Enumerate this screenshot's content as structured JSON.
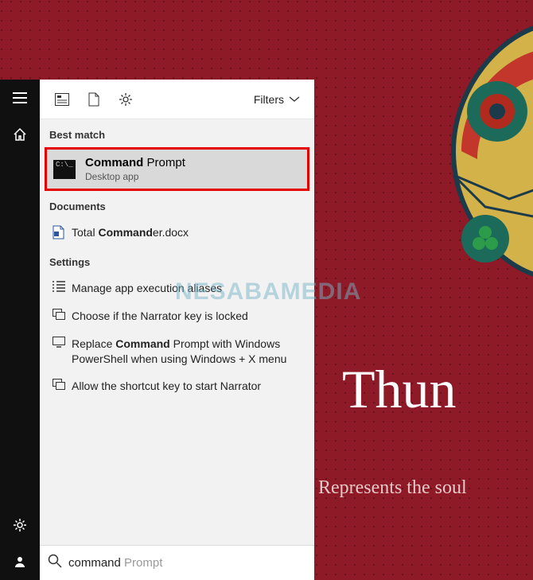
{
  "wallpaper": {
    "title_visible": "Thun",
    "subtitle_visible": "Represents the soul"
  },
  "watermark": "NESABAMEDIA",
  "sidebar": {
    "items": [
      "hamburger",
      "home",
      "settings",
      "account"
    ]
  },
  "panel": {
    "header": {
      "icons": [
        "apps",
        "document",
        "settings"
      ],
      "filters_label": "Filters"
    },
    "sections": {
      "best_match_label": "Best match",
      "best_match": {
        "title_bold": "Command",
        "title_rest": " Prompt",
        "subtitle": "Desktop app",
        "icon_text": "C:\\_"
      },
      "documents_label": "Documents",
      "documents": [
        {
          "pre": "Total ",
          "bold": "Command",
          "post": "er.docx"
        }
      ],
      "settings_label": "Settings",
      "settings": [
        {
          "text": "Manage app execution aliases"
        },
        {
          "text": "Choose if the Narrator key is locked"
        },
        {
          "pre": "Replace ",
          "bold": "Command",
          "post": " Prompt with Windows PowerShell when using Windows + X menu"
        },
        {
          "text": "Allow the shortcut key to start Narrator"
        }
      ]
    },
    "search": {
      "typed": "command",
      "ghost": " Prompt"
    }
  }
}
